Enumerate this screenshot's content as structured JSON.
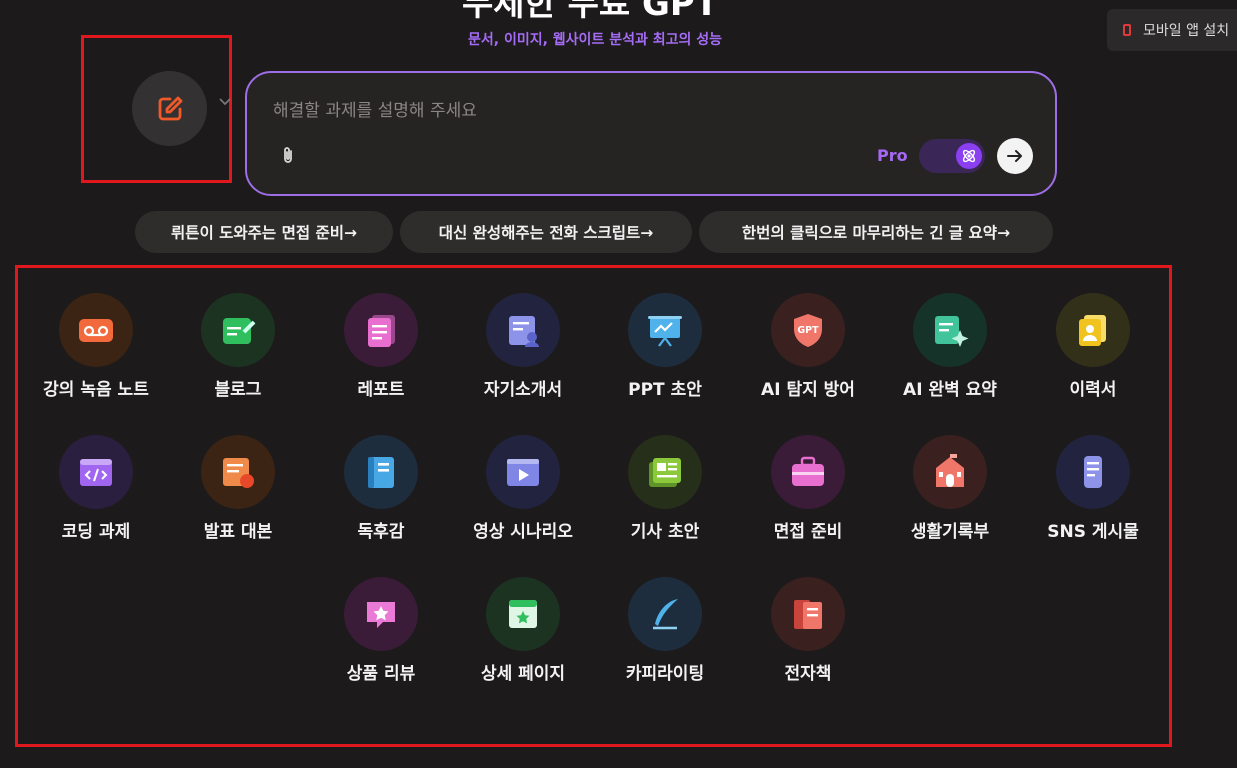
{
  "header": {
    "title": "무제한 무료 GPT",
    "subtitle": "문서, 이미지, 웹사이트 분석과 최고의 성능"
  },
  "install_button": {
    "label": "모바일 앱 설치"
  },
  "prompt": {
    "placeholder": "해결할 과제를 설명해 주세요",
    "pro_label": "Pro",
    "pro_enabled": true
  },
  "suggestions": [
    {
      "label": "뤼튼이 도와주는 면접 준비→"
    },
    {
      "label": "대신 완성해주는 전화 스크립트→"
    },
    {
      "label": "한번의 클릭으로 마무리하는 긴 글 요약→"
    }
  ],
  "tools": [
    {
      "label": "강의 녹음 노트",
      "icon": "voicemail-tape-icon",
      "bg": "#3b2413",
      "color": "#f26a3c"
    },
    {
      "label": "블로그",
      "icon": "blog-pencil-icon",
      "bg": "#1c3322",
      "color": "#2fbf5e"
    },
    {
      "label": "레포트",
      "icon": "report-document-icon",
      "bg": "#3a1c38",
      "color": "#e86fcf"
    },
    {
      "label": "자기소개서",
      "icon": "profile-document-icon",
      "bg": "#22233f",
      "color": "#8c93e8"
    },
    {
      "label": "PPT 초안",
      "icon": "presentation-board-icon",
      "bg": "#1e2d3d",
      "color": "#4fb2ea"
    },
    {
      "label": "AI 탐지 방어",
      "icon": "gpt-shield-icon",
      "bg": "#3b2020",
      "color": "#f0766a",
      "text": "GPT"
    },
    {
      "label": "AI 완벽 요약",
      "icon": "summary-sparkle-icon",
      "bg": "#163329",
      "color": "#41c49a"
    },
    {
      "label": "이력서",
      "icon": "resume-id-icon",
      "bg": "#33301a",
      "color": "#f0c31f"
    },
    {
      "label": "코딩 과제",
      "icon": "code-window-icon",
      "bg": "#2b1f40",
      "color": "#a066f0"
    },
    {
      "label": "발표 대본",
      "icon": "script-chart-icon",
      "bg": "#3b2413",
      "color": "#f08a4a"
    },
    {
      "label": "독후감",
      "icon": "book-icon",
      "bg": "#1e2d3d",
      "color": "#48a8e6"
    },
    {
      "label": "영상 시나리오",
      "icon": "video-player-icon",
      "bg": "#22233f",
      "color": "#7f86e6"
    },
    {
      "label": "기사 초안",
      "icon": "newspaper-icon",
      "bg": "#262f1a",
      "color": "#8cc93a"
    },
    {
      "label": "면접 준비",
      "icon": "briefcase-icon",
      "bg": "#3a1c38",
      "color": "#e86fcf"
    },
    {
      "label": "생활기록부",
      "icon": "school-building-icon",
      "bg": "#3b2020",
      "color": "#f0766a"
    },
    {
      "label": "SNS 게시물",
      "icon": "mobile-post-icon",
      "bg": "#22233f",
      "color": "#8c93e8"
    },
    {
      "label": "상품 리뷰",
      "icon": "star-review-icon",
      "bg": "#3a1c38",
      "color": "#ea7ad6"
    },
    {
      "label": "상세 페이지",
      "icon": "star-page-icon",
      "bg": "#1c3322",
      "color": "#2fbf5e"
    },
    {
      "label": "카피라이팅",
      "icon": "quill-pen-icon",
      "bg": "#1e2d3d",
      "color": "#4fb2ea"
    },
    {
      "label": "전자책",
      "icon": "ebook-icon",
      "bg": "#3b2020",
      "color": "#f0766a"
    }
  ]
}
